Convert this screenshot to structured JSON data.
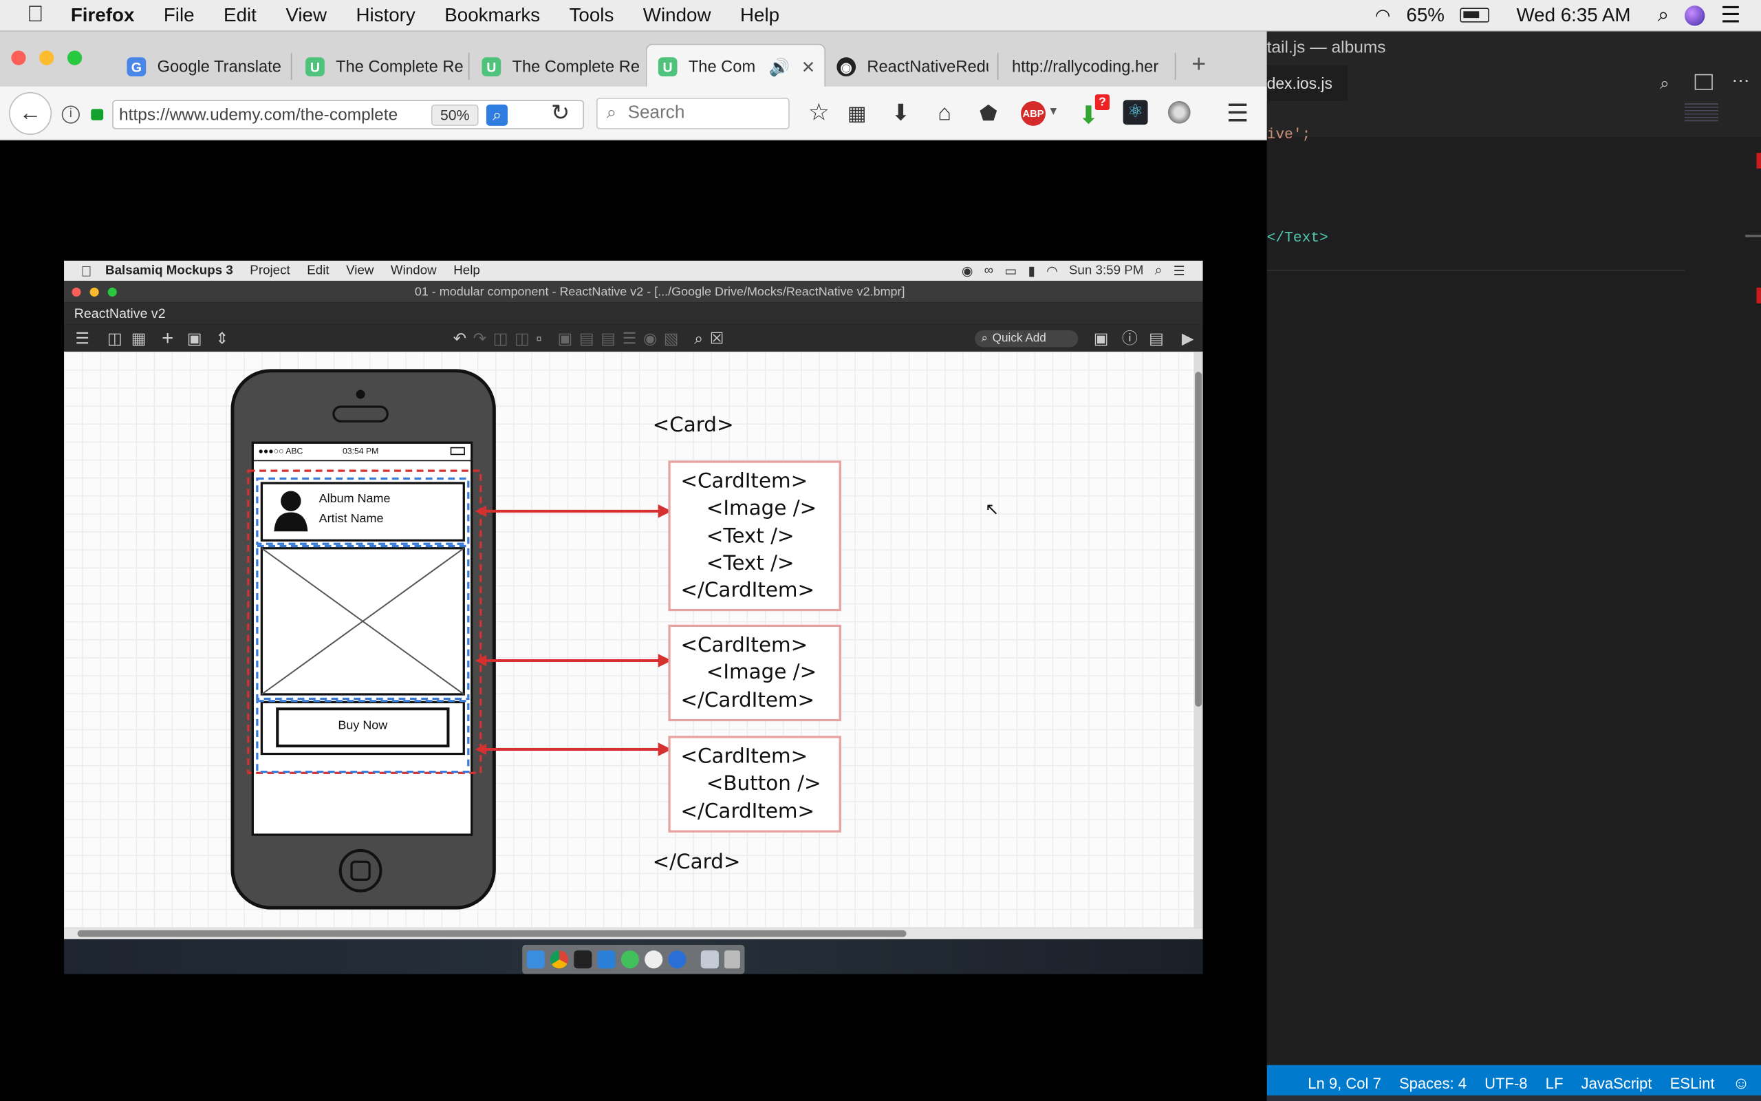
{
  "menubar": {
    "app_name": "Firefox",
    "items": [
      "File",
      "Edit",
      "View",
      "History",
      "Bookmarks",
      "Tools",
      "Window",
      "Help"
    ],
    "battery": "65%",
    "clock": "Wed 6:35 AM"
  },
  "firefox": {
    "tabs": [
      {
        "title": "Google Translate",
        "icon": "google-translate-icon"
      },
      {
        "title": "The Complete Re",
        "icon": "udemy-icon"
      },
      {
        "title": "The Complete Re",
        "icon": "udemy-icon"
      },
      {
        "title": "The Comp",
        "icon": "udemy-icon"
      },
      {
        "title": "ReactNativeRedu",
        "icon": "github-icon"
      },
      {
        "title": "http://rallycoding.her",
        "icon": ""
      }
    ],
    "url": "https://www.udemy.com/the-complete",
    "zoom": "50%",
    "search_placeholder": "Search",
    "abp_badge": "ABP",
    "downloads_badge": "?"
  },
  "vscode": {
    "title": "tail.js — albums",
    "tab_label": "dex.ios.js",
    "code_lines": [
      "ive';",
      "</Text>"
    ],
    "status": [
      "Ln 9, Col 7",
      "Spaces: 4",
      "UTF-8",
      "LF",
      "JavaScript",
      "ESLint"
    ]
  },
  "balsamiq": {
    "menu_items": [
      "Balsamiq Mockups 3",
      "Project",
      "Edit",
      "View",
      "Window",
      "Help"
    ],
    "menu_clock": "Sun 3:59 PM",
    "window_title": "01 - modular component - ReactNative v2 - [.../Google Drive/Mocks/ReactNative v2.bmpr]",
    "project_name": "ReactNative v2",
    "quick_add": "Quick Add",
    "phone": {
      "carrier": "●●●○○ ABC",
      "time": "03:54 PM",
      "album_name": "Album Name",
      "artist_name": "Artist Name",
      "button_label": "Buy Now"
    },
    "card_open": "<Card>",
    "card_close": "</Card>",
    "boxes": [
      {
        "lines": [
          "<CardItem>",
          "    <Image />",
          "    <Text />",
          "    <Text />",
          "</CardItem>"
        ]
      },
      {
        "lines": [
          "<CardItem>",
          "    <Image />",
          "</CardItem>"
        ]
      },
      {
        "lines": [
          "<CardItem>",
          "    <Button />",
          "</CardItem>"
        ]
      }
    ]
  },
  "colors": {
    "accent_red": "#d63031",
    "dashed_blue": "#3b7bd8",
    "vscode_status": "#007acc"
  }
}
